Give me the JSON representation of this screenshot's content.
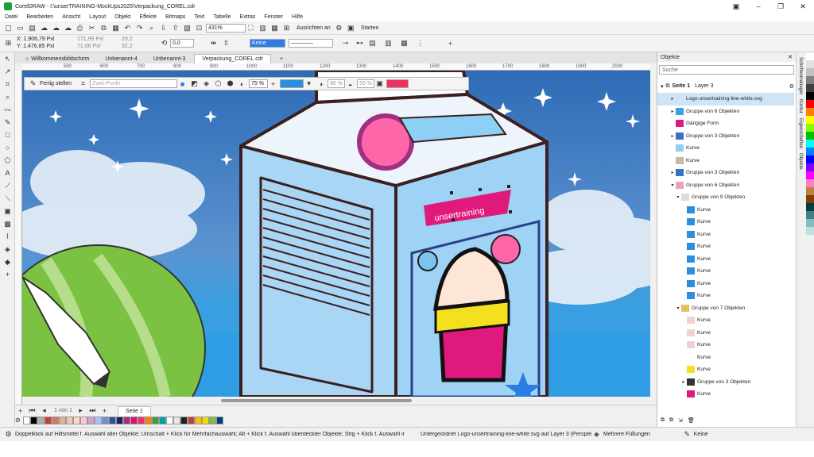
{
  "window": {
    "title": "CorelDRAW - I:\\unserTRAINING-MockUps2025\\Verpackung_COREL.cdr"
  },
  "menu": [
    "Datei",
    "Bearbeiten",
    "Ansicht",
    "Layout",
    "Objekt",
    "Effekte",
    "Bitmaps",
    "Text",
    "Tabelle",
    "Extras",
    "Fenster",
    "Hilfe"
  ],
  "toolbar": {
    "zoom": "431%",
    "align_label": "Ausrichten an",
    "start_label": "Starten",
    "fill_value": "Keine"
  },
  "props": {
    "x": "X: 1.906,79 Pxl",
    "y": "Y: 1.476,85 Pxl",
    "w": "171,99 Pxl",
    "h": "71,66 Pxl",
    "sx": "29,2",
    "sy": "32,2",
    "angle": "0,0"
  },
  "tabs": [
    "Willkommensbildschirm",
    "Unbenannt-4",
    "Unbenannt-3",
    "Verpackung_COREL.cdr"
  ],
  "ruler_ticks": [
    "500",
    "600",
    "700",
    "800",
    "900",
    "1000",
    "1100",
    "1200",
    "1300",
    "1400",
    "1500",
    "1600",
    "1700",
    "1800",
    "1900",
    "2000"
  ],
  "context": {
    "done": "Fertig stellen",
    "mode": "Zwei-Punkt",
    "opacity": "75 %",
    "mid": "80 %",
    "end": "50 %"
  },
  "page": {
    "counter": "1 von 1",
    "name": "Seite 1"
  },
  "status": {
    "hint": "Doppelklick auf Hilfsmittel f. Auswahl aller Objekte; Umschalt + Klick für Mehrfachauswahl; Alt + Klick f. Auswahl überdeckter Objekte; Strg + Klick f. Auswahl in Gruppen",
    "info": "Untergeordnet Logo-unsertraining-line-white.svg auf Layer 3  (Perspektive)",
    "fills": "Mehrere Füllungen",
    "outline": "Keine"
  },
  "panel": {
    "title": "Objekte",
    "search": "Suche",
    "page": "Seite 1",
    "layer": "Layer 3",
    "items": [
      {
        "label": "Logo-unsertraining-line-white.svg",
        "indent": 1,
        "arrow": "▸",
        "sel": true,
        "color": "#cfe4f7"
      },
      {
        "label": "Gruppe von 6 Objekten",
        "indent": 1,
        "arrow": "▸",
        "color": "#3aa0e6"
      },
      {
        "label": "Gängige Form",
        "indent": 1,
        "arrow": "",
        "color": "#e0197d"
      },
      {
        "label": "Gruppe von 3 Objekten",
        "indent": 1,
        "arrow": "▸",
        "color": "#3a72c8"
      },
      {
        "label": "Kurve",
        "indent": 1,
        "arrow": "",
        "color": "#8ecff5"
      },
      {
        "label": "Kurve",
        "indent": 1,
        "arrow": "",
        "color": "#c8b8a8"
      },
      {
        "label": "Gruppe von 3 Objekten",
        "indent": 1,
        "arrow": "▸",
        "color": "#3a72c8"
      },
      {
        "label": "Gruppe von 6 Objekten",
        "indent": 1,
        "arrow": "▾",
        "color": "#f0a0c0"
      },
      {
        "label": "Gruppe von 9 Objekten",
        "indent": 2,
        "arrow": "▾",
        "color": "#dddddd"
      },
      {
        "label": "Kurve",
        "indent": 3,
        "arrow": "",
        "color": "#2a8fe0"
      },
      {
        "label": "Kurve",
        "indent": 3,
        "arrow": "",
        "color": "#2a8fe0"
      },
      {
        "label": "Kurve",
        "indent": 3,
        "arrow": "",
        "color": "#2a8fe0"
      },
      {
        "label": "Kurve",
        "indent": 3,
        "arrow": "",
        "color": "#2a8fe0"
      },
      {
        "label": "Kurve",
        "indent": 3,
        "arrow": "",
        "color": "#2a8fe0"
      },
      {
        "label": "Kurve",
        "indent": 3,
        "arrow": "",
        "color": "#2a8fe0"
      },
      {
        "label": "Kurve",
        "indent": 3,
        "arrow": "",
        "color": "#2a8fe0"
      },
      {
        "label": "Kurve",
        "indent": 3,
        "arrow": "",
        "color": "#2a8fe0"
      },
      {
        "label": "Gruppe von 7 Objekten",
        "indent": 2,
        "arrow": "▾",
        "color": "#e8c060"
      },
      {
        "label": "Kurve",
        "indent": 3,
        "arrow": "",
        "color": "#f0d0d0"
      },
      {
        "label": "Kurve",
        "indent": 3,
        "arrow": "",
        "color": "#f0d0d0"
      },
      {
        "label": "Kurve",
        "indent": 3,
        "arrow": "",
        "color": "#f0d0d0"
      },
      {
        "label": "Kurve",
        "indent": 3,
        "arrow": "",
        "color": "#ffffff"
      },
      {
        "label": "Kurve",
        "indent": 3,
        "arrow": "",
        "color": "#f5e020"
      },
      {
        "label": "Gruppe von 3 Objekten",
        "indent": 3,
        "arrow": "▸",
        "color": "#333333"
      },
      {
        "label": "Kurve",
        "indent": 3,
        "arrow": "",
        "color": "#e0197d"
      }
    ]
  },
  "sidetabs": [
    "Schriftenmanager",
    "Kontur",
    "Eigenschaften",
    "Objekte"
  ],
  "palette": [
    "#ffffff",
    "#000000",
    "#b0b0b0",
    "#c83c3c",
    "#d07860",
    "#e8b090",
    "#f0c8b0",
    "#f8d8d0",
    "#fcc8e0",
    "#d0a0d0",
    "#a0c8f0",
    "#7090d0",
    "#3050a0",
    "#202060",
    "#a03080",
    "#e01070",
    "#f03060",
    "#ff8000",
    "#40a040",
    "#00a0a0",
    "#ffffff",
    "#e8e8e8",
    "#202020",
    "#c04040",
    "#ffc000",
    "#f0e000",
    "#80c040",
    "#004080"
  ],
  "colstrip": [
    "#ffffff",
    "#e0e0e0",
    "#c0c0c0",
    "#808080",
    "#404040",
    "#000000",
    "#ff0000",
    "#ff8000",
    "#ffff00",
    "#80ff00",
    "#00c000",
    "#00ffff",
    "#0080ff",
    "#0000ff",
    "#8000ff",
    "#ff00ff",
    "#ff80c0",
    "#c08040",
    "#804000",
    "#004040",
    "#408080",
    "#80c0c0",
    "#c0e0e0",
    "#f0f0f0"
  ],
  "logo_text": "unsertraining"
}
